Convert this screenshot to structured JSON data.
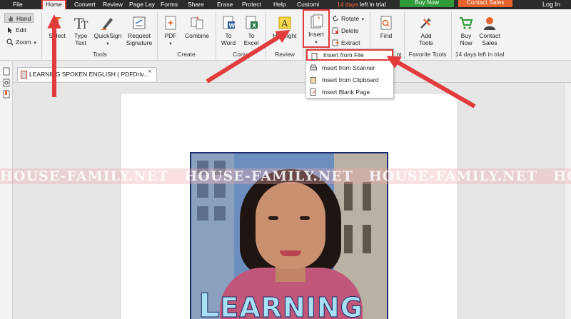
{
  "menubar": {
    "items": [
      "File",
      "Home",
      "Convert",
      "Review",
      "Page Lay",
      "Forms",
      "Share",
      "Erase",
      "Protect",
      "Help",
      "Customi"
    ],
    "trial_days": "14 days",
    "trial_rest": "left in trial",
    "buy_now": "Buy Now",
    "contact_sales": "Contact Sales",
    "login": "Log In"
  },
  "ribbon": {
    "mode": {
      "hand": "Hand",
      "edit": "Edit",
      "zoom": "Zoom"
    },
    "tools_group": {
      "label": "Tools",
      "select": "Select",
      "type_text_1": "Type",
      "type_text_2": "Text",
      "quicksign": "QuickSign",
      "request_1": "Request",
      "request_2": "Signature"
    },
    "create_group": {
      "label": "Create",
      "pdf": "PDF",
      "combine": "Combine"
    },
    "convert_group": {
      "label": "Conv",
      "to_word_1": "To",
      "to_word_2": "Word",
      "to_excel_1": "To",
      "to_excel_2": "Excel"
    },
    "review_group": {
      "label": "Review",
      "highlight": "Highlight"
    },
    "pages_group": {
      "insert": "Insert",
      "rotate": "Rotate",
      "delete": "Delete",
      "extract": "Extract"
    },
    "find_group": {
      "find": "Find",
      "label_tail": "nt"
    },
    "favorite_group": {
      "label": "Favorite Tools",
      "add_1": "Add",
      "add_2": "Tools"
    },
    "trial_group": {
      "label": "14 days left in trial",
      "buy_1": "Buy",
      "buy_2": "Now",
      "contact_1": "Contact",
      "contact_2": "Sales"
    }
  },
  "insert_menu": {
    "items": [
      "Insert from File",
      "Insert from Scanner",
      "Insert from Clipboard",
      "Insert Blank Page"
    ]
  },
  "document": {
    "tab_title": "LEARNING SPOKEN ENGLISH ( PDFDriv...",
    "tab_close": "×",
    "cover_title_big": "L",
    "cover_title_rest": "EARNING"
  },
  "watermark": {
    "text": [
      "HOUSE-FAMILY.NET",
      "HOUSE-FAMILY.NET",
      "HOUSE-FAMILY.NET",
      "HOU"
    ]
  },
  "colors": {
    "accent_red": "#e23b3b",
    "buy_now_green": "#2f9a3a",
    "contact_orange": "#e8632c",
    "menubar_dark": "#2b2b2b"
  }
}
